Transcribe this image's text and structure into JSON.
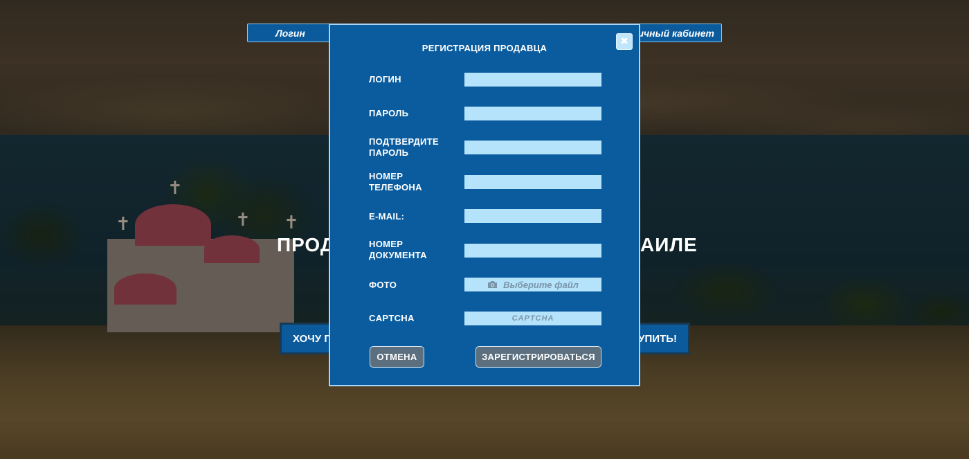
{
  "header": {
    "login_label": "Логин",
    "cabinet_label": "Личный кабинет"
  },
  "hero": {
    "title_left_visible": "ПРОД",
    "title_right_visible": "АИЛЕ",
    "sell_button_visible": "ХОЧУ П",
    "buy_button_visible": "КУПИТЬ!"
  },
  "modal": {
    "title": "РЕГИСТРАЦИЯ ПРОДАВЦА",
    "close_icon": "close-icon",
    "fields": [
      {
        "label": "ЛОГИН",
        "value": ""
      },
      {
        "label": "ПАРОЛЬ",
        "value": ""
      },
      {
        "label": "ПОДТВЕРДИТЕ ПАРОЛЬ",
        "value": ""
      },
      {
        "label": "НОМЕР ТЕЛЕФОНА",
        "value": ""
      },
      {
        "label": "E-MAIL:",
        "value": ""
      },
      {
        "label": "НОМЕР ДОКУМЕНТА",
        "value": ""
      }
    ],
    "photo": {
      "label": "ФОТО",
      "button_text": "Выберите файл",
      "icon": "camera-icon"
    },
    "captcha": {
      "label": "CAPTCHA",
      "text": "CAPTCHA"
    },
    "cancel_label": "ОТМЕНА",
    "register_label": "ЗАРЕГИСТРИРОВАТЬСЯ"
  },
  "colors": {
    "modal_bg": "#0a5c9e",
    "input_bg": "#b4e3fb",
    "button_bg": "#5b6f7f"
  }
}
